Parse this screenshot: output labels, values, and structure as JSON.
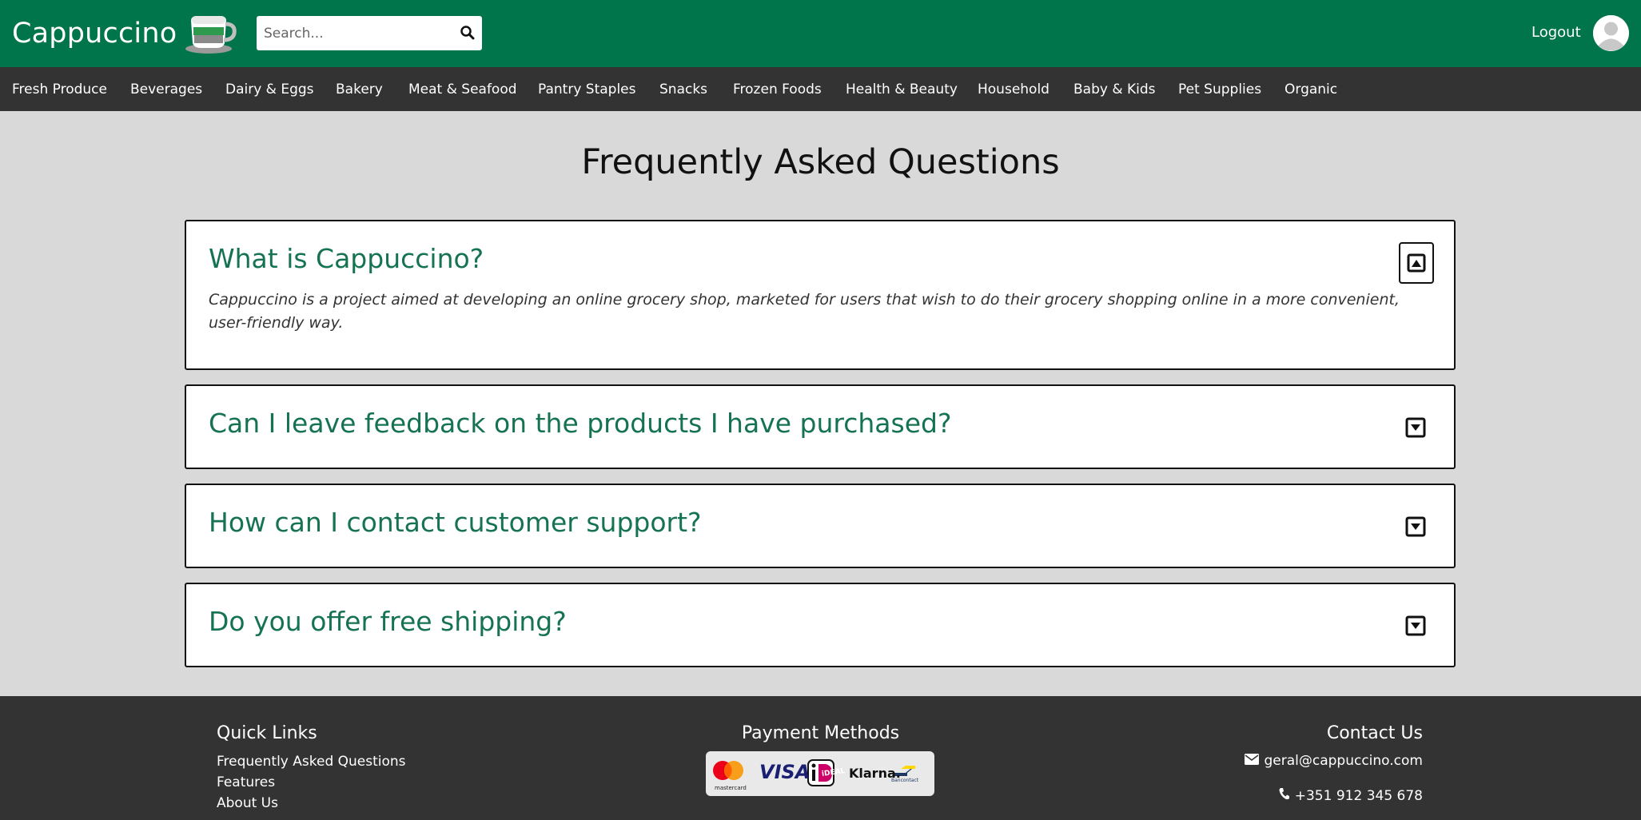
{
  "header": {
    "brand": "Cappuccino",
    "search_placeholder": "Search...",
    "logout_label": "Logout"
  },
  "categories": [
    "Fresh Produce",
    "Beverages",
    "Dairy & Eggs",
    "Bakery",
    "Meat & Seafood",
    "Pantry Staples",
    "Snacks",
    "Frozen Foods",
    "Health & Beauty",
    "Household",
    "Baby & Kids",
    "Pet Supplies",
    "Organic"
  ],
  "main": {
    "title": "Frequently Asked Questions",
    "faqs": [
      {
        "question": "What is Cappuccino?",
        "answer": "Cappuccino is a project aimed at developing an online grocery shop, marketed for users that wish to do their grocery shopping online in a more convenient, user-friendly way.",
        "expanded": true
      },
      {
        "question": "Can I leave feedback on the products I have purchased?",
        "answer": "",
        "expanded": false
      },
      {
        "question": "How can I contact customer support?",
        "answer": "",
        "expanded": false
      },
      {
        "question": "Do you offer free shipping?",
        "answer": "",
        "expanded": false
      }
    ]
  },
  "footer": {
    "quick_links_title": "Quick Links",
    "quick_links": [
      "Frequently Asked Questions",
      "Features",
      "About Us"
    ],
    "payment_title": "Payment Methods",
    "payment_methods": [
      "mastercard",
      "VISA",
      "iDEAL",
      "Klarna.",
      "Bancontact"
    ],
    "contact_title": "Contact Us",
    "email": "geral@cappuccino.com",
    "phone": "+351 912 345 678"
  },
  "colors": {
    "brand_green": "#00754c",
    "question_green": "#167352",
    "nav_dark": "#333333",
    "page_bg": "#d9d9d9"
  },
  "icons": [
    "coffee-cup-logo-icon",
    "search-icon",
    "user-avatar-icon",
    "collapse-arrow-icon",
    "expand-arrow-icon",
    "envelope-icon",
    "phone-icon"
  ]
}
